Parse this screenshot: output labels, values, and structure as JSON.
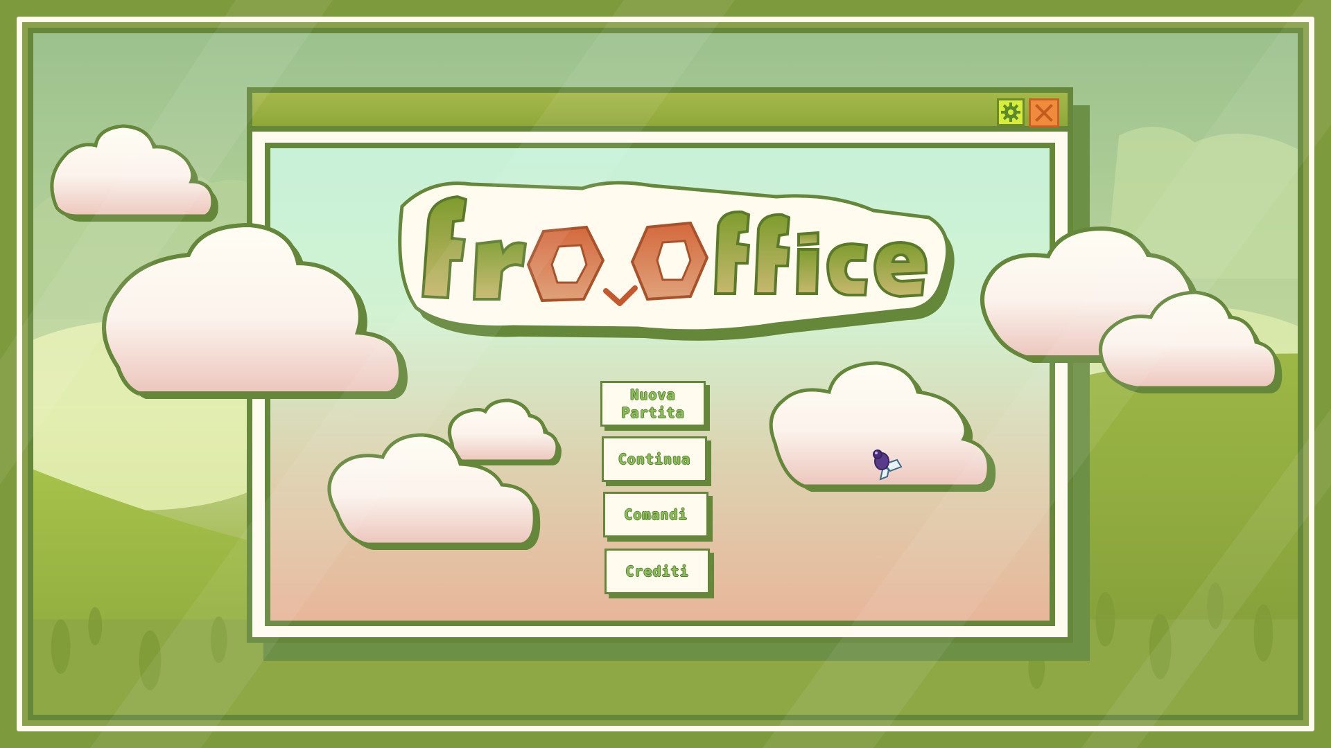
{
  "game": {
    "title_logo": "frooffice",
    "window": {
      "settings_icon": "gear-icon",
      "close_icon": "close-icon"
    },
    "menu": {
      "new_game": "Nuova Partita",
      "continue": "Continua",
      "controls": "Comandi",
      "credits": "Crediti"
    },
    "cursor": "fly-cursor-icon"
  },
  "colors": {
    "frame_green": "#64873a",
    "cream": "#fffbef",
    "logo_green": "#8aa63a",
    "logo_orange": "#d4693e",
    "close_orange": "#f08a3c",
    "gear_yellow": "#d8ec3c"
  }
}
